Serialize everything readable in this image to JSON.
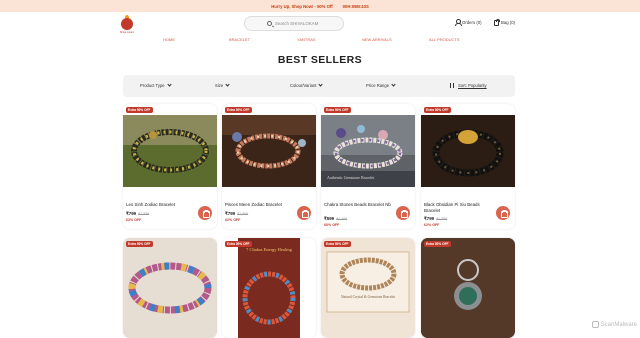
{
  "promo": {
    "text": "Hurry Up, Shop Now! - 50% Off",
    "timer": "00H:05M:43S"
  },
  "header": {
    "logo_text": "Shiva Lokam",
    "search_placeholder": "Search SHIVALOKAM",
    "orders_label": "Orders (0)",
    "bag_label": "Bag (0)"
  },
  "nav": {
    "items": [
      "HOME",
      "BRACELET",
      "YANTRAS",
      "NEW ARRIVALS",
      "ALL PRODUCTS"
    ]
  },
  "page_title": "BEST SELLERS",
  "filters": {
    "product_type": "Product Type",
    "size": "Size",
    "colour": "Colour/Variant",
    "price": "Price Range",
    "sort": "Sort: Popularity"
  },
  "products": [
    {
      "badge": "Extra 50% OFF",
      "name": "Leo Sinh Zodiac Bracelet",
      "price": "₹799",
      "mrp": "₹1,999",
      "discount": "62% OFF"
    },
    {
      "badge": "Extra 50% OFF",
      "name": "Pisces Meen Zodiac Bracelet",
      "price": "₹799",
      "mrp": "₹1,999",
      "discount": "62% OFF"
    },
    {
      "badge": "Extra 50% OFF",
      "name": "Chakra Stones Beads Bracelet Nb",
      "price": "₹599",
      "mrp": "₹1,499",
      "discount": "60% OFF"
    },
    {
      "badge": "Extra 50% OFF",
      "name": "Black Obsidian Pi Xiu Beads Bracelet",
      "price": "₹799",
      "mrp": "₹1,999",
      "discount": "62% OFF"
    }
  ],
  "products_row2": [
    {
      "badge": "Extra 50% OFF"
    },
    {
      "badge": "Extra 50% OFF",
      "overlay": "7 Chakra Energy Healing"
    },
    {
      "badge": "Extra 50% OFF",
      "overlay": "Natural Crystal & Gemstone Bracelet"
    },
    {
      "badge": "Extra 50% OFF"
    }
  ],
  "product3_caption": "Authentic Gemstone Bracelet",
  "watermark": "ScanMalware",
  "colors": {
    "accent": "#c0392b",
    "promo_bg": "#fbe3d6",
    "nav": "#d9574a"
  }
}
